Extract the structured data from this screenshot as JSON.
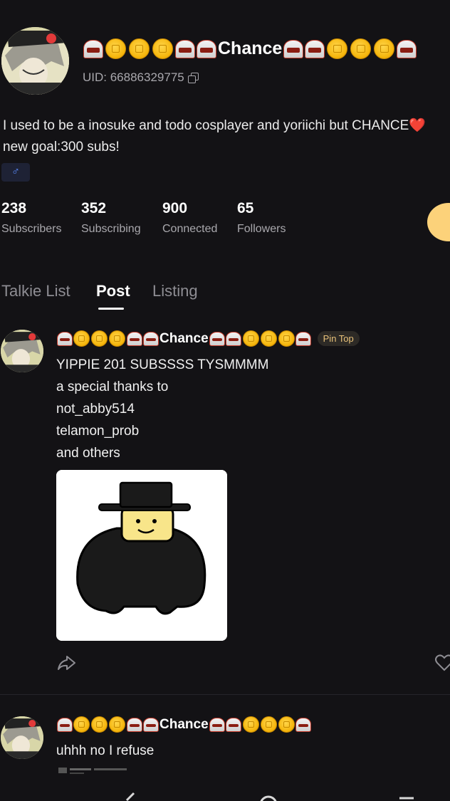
{
  "profile": {
    "display_name": "Chance",
    "uid": "UID: 66886329775",
    "bio_line1": "I used to be a inosuke and todo cosplayer and yoriichi but CHANCE",
    "bio_emoji": "❤️",
    "bio_line2": "new goal:300 subs!",
    "gender_symbol": "♂"
  },
  "stats": [
    {
      "value": "238",
      "label": "Subscribers"
    },
    {
      "value": "352",
      "label": "Subscribing"
    },
    {
      "value": "900",
      "label": "Connected"
    },
    {
      "value": "65",
      "label": "Followers"
    }
  ],
  "tabs": [
    {
      "label": "Talkie List"
    },
    {
      "label": "Post"
    },
    {
      "label": "Listing"
    }
  ],
  "posts": [
    {
      "author": "Chance",
      "badge": "Pin Top",
      "lines": [
        "YIPPIE 201 SUBSSSS TYSMMMM",
        "a special thanks to",
        "not_abby514",
        "telamon_prob",
        "and others"
      ]
    },
    {
      "author": "Chance",
      "lines": [
        "uhhh no I refuse"
      ]
    }
  ],
  "icons": {
    "copy": "copy-icon",
    "share": "share-icon",
    "like": "heart-icon",
    "slot_emoji": "slot-machine-emoji",
    "coin_emoji": "coin-emoji"
  },
  "colors": {
    "background": "#131215",
    "accent": "#fcd27a",
    "badge_text": "#e9c27a",
    "gender_tag": "#5b8cff"
  }
}
